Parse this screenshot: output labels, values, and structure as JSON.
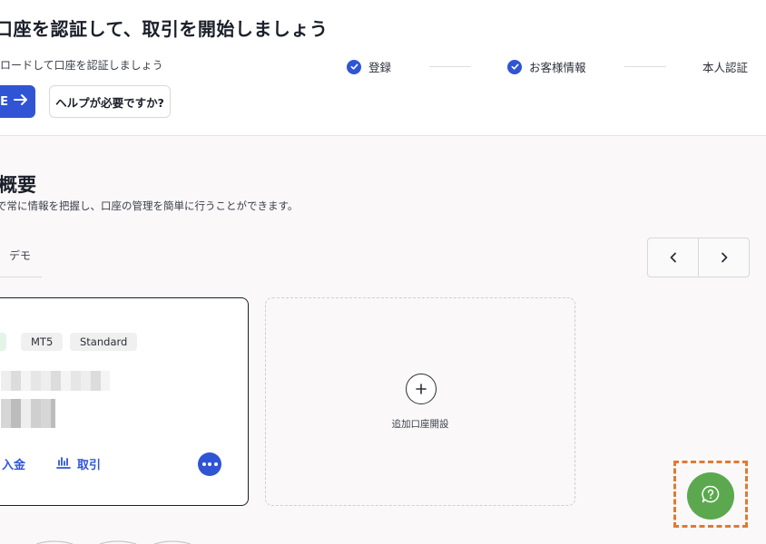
{
  "header": {
    "title": "口座を認証して、取引を開始しましょう",
    "subtitle": "ロードして口座を認証しましょう",
    "verify_button_label": "E",
    "help_button_label": "ヘルプが必要ですか?"
  },
  "steps": [
    {
      "label": "登録",
      "done": true
    },
    {
      "label": "お客様情報",
      "done": true
    },
    {
      "label": "本人認証",
      "done": false
    }
  ],
  "overview": {
    "title": "概要",
    "description": "で常に情報を把握し、口座の管理を簡単に行うことができます。",
    "tab_demo": "デモ"
  },
  "account_card": {
    "tags": [
      "MT5",
      "Standard"
    ],
    "actions": {
      "deposit": "入金",
      "trade": "取引"
    }
  },
  "add_account": {
    "label": "追加口座開設"
  },
  "icons": {
    "step_done": "check-circle-icon",
    "verify_arrow": "arrow-right-icon",
    "prev": "chevron-left-icon",
    "next": "chevron-right-icon",
    "more": "more-dots-icon",
    "add": "plus-icon",
    "chat": "help-chat-icon",
    "trade": "chart-icon"
  },
  "colors": {
    "accent": "#2f55d4",
    "chat": "#5ca84f",
    "highlight": "#e07a33"
  }
}
